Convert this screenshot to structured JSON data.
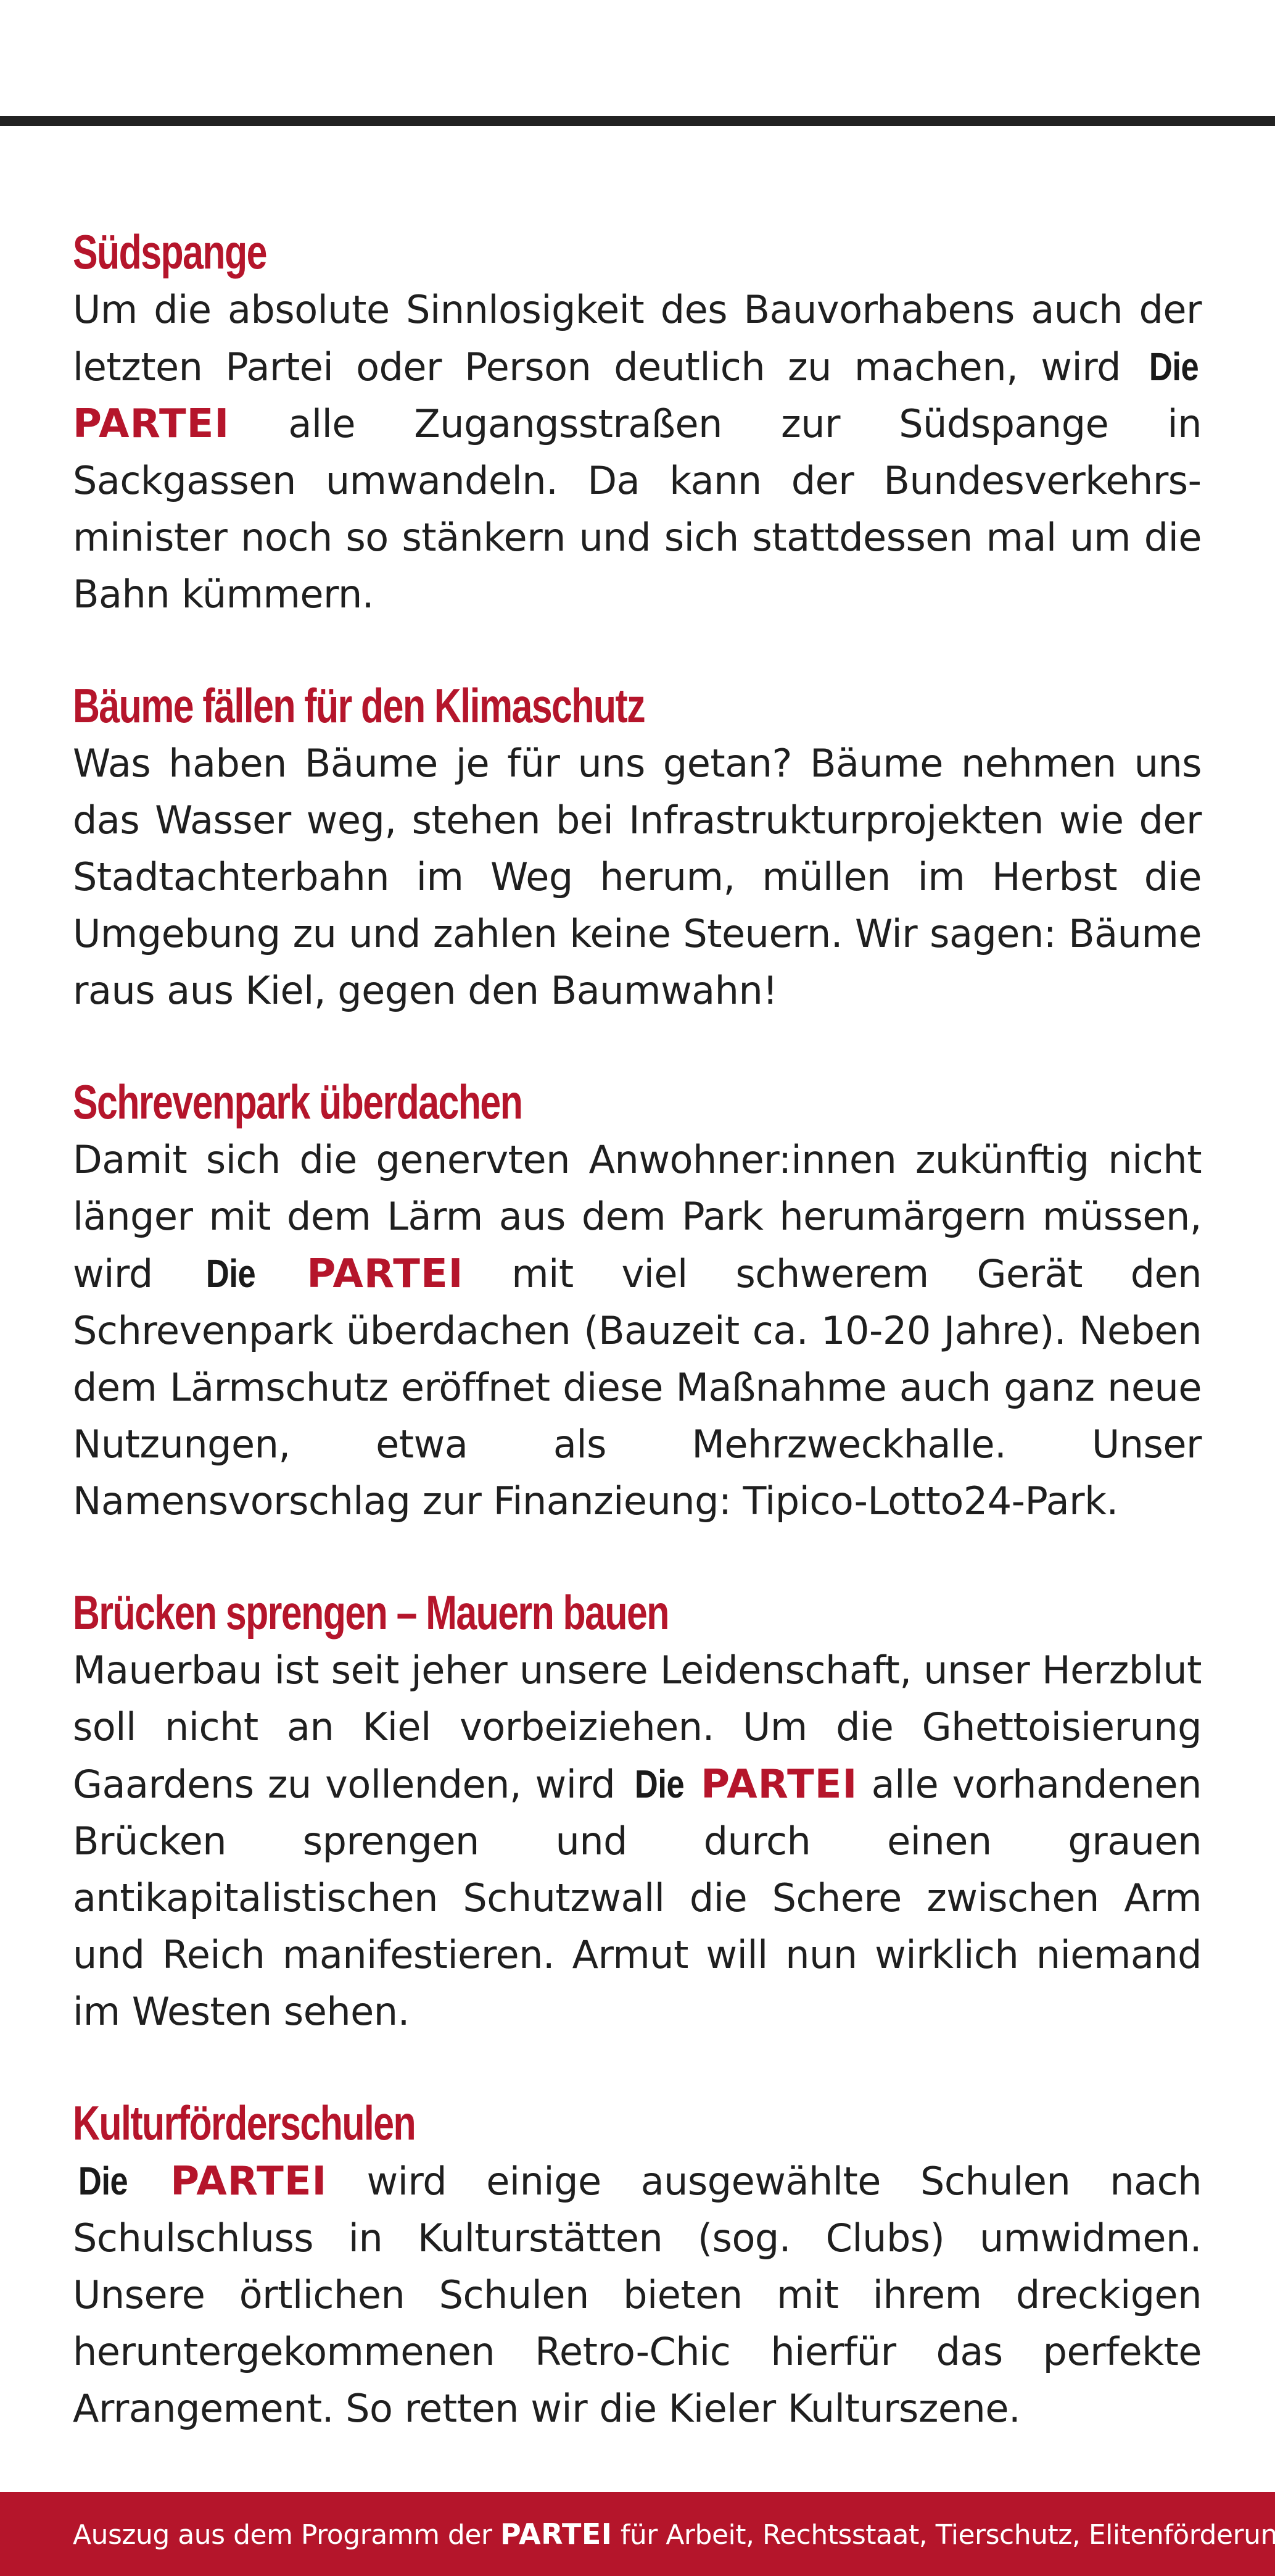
{
  "brand": {
    "die": "Die",
    "partei": "PARTEI",
    "accent_color": "#b5152b",
    "text_color": "#1f1f1f"
  },
  "sections": [
    {
      "title": "Südspange",
      "p1": "Um die absolute Sinnlosigkeit des Bauvorhabens auch der letzten Partei oder Person deutlich zu machen, wird",
      "p2": "alle Zugangsstraßen zur Südspange in Sackgassen umwandeln. Da kann der Bundesverkehrs­minister noch so stänkern und sich stattdessen mal um die Bahn kümmern."
    },
    {
      "title": "Bäume fällen für den Klimaschutz",
      "p1": "Was haben Bäume je für uns getan? Bäume nehmen uns das Wasser weg, stehen bei Infrastrukturprojekten wie der Stadtachterbahn im Weg herum, müllen im Herbst die Umgebung zu und zahlen keine Steuern. Wir sagen: Bäume raus aus Kiel, gegen den Baumwahn!"
    },
    {
      "title": "Schrevenpark überdachen",
      "p1": "Damit sich die genervten Anwohner:innen zukünftig nicht länger mit dem Lärm aus dem Park herumärgern müssen, wird",
      "p2": "mit viel schwerem Gerät den Schrevenpark überdachen (Bauzeit ca. 10-20 Jahre). Neben dem Lärmschutz eröffnet diese Maßnahme auch ganz neue Nutzungen, etwa als Mehrzweckhalle. Unser Namensvorschlag zur Finanzieung: Tipico-Lotto24-Park."
    },
    {
      "title": "Brücken sprengen – Mauern bauen",
      "p1": "Mauerbau ist seit jeher unsere Leidenschaft, unser Herzblut soll nicht an Kiel vorbeiziehen. Um die Ghetto­isierung Gaardens zu vollenden, wird",
      "p2": "alle vorhandenen Brücken sprengen und durch einen grauen antikapitalistischen Schutzwall die Schere zwischen Arm und Reich manifestieren. Armut will nun wirklich niemand im Westen sehen."
    },
    {
      "title": "Kulturförderschulen",
      "p2": "wird einige ausgewählte Schulen nach Schulschluss in Kulturstätten (sog. Clubs) umwidmen. Unsere örtlichen Schulen bieten mit ihrem dreckigen heruntergekommenen Retro-Chic hierfür das perfekte Arrangement. So retten wir die Kieler Kulturszene."
    }
  ],
  "footer": {
    "prefix": "Auszug aus dem Programm der",
    "partei": "PARTEI",
    "suffix": "für Arbeit, Rechtsstaat, Tierschutz, Elitenförderung"
  }
}
